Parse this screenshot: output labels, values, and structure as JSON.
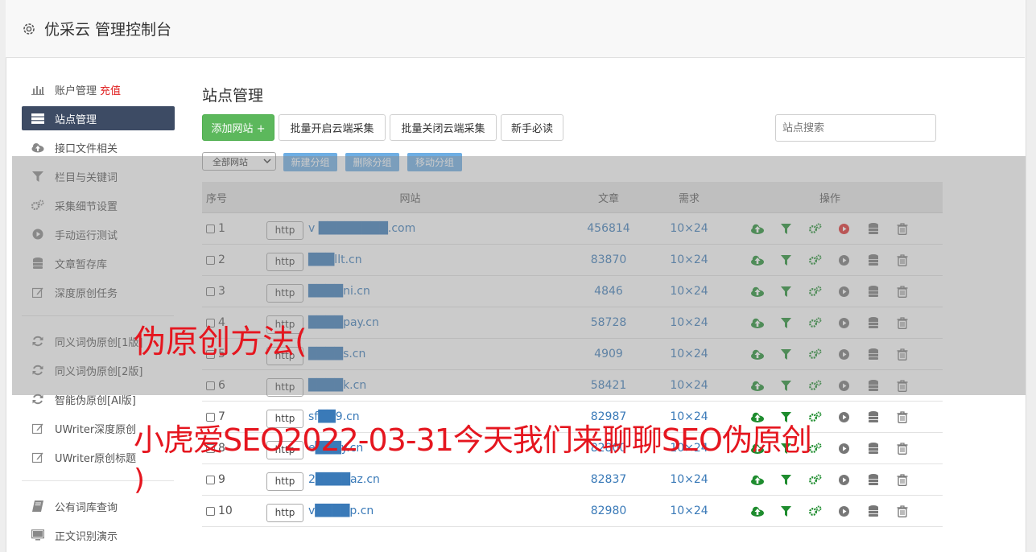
{
  "app": {
    "title": "优采云 管理控制台",
    "icon": "gear-icon"
  },
  "sidebar": {
    "groups": [
      [
        {
          "label": "账户管理",
          "extra": "充值",
          "icon": "bar-chart-icon"
        },
        {
          "label": "站点管理",
          "icon": "server-icon",
          "active": true
        },
        {
          "label": "接口文件相关",
          "icon": "cloud-upload-icon"
        },
        {
          "label": "栏目与关键词",
          "icon": "filter-icon"
        },
        {
          "label": "采集细节设置",
          "icon": "cogs-icon"
        },
        {
          "label": "手动运行测试",
          "icon": "play-circle-icon"
        },
        {
          "label": "文章暂存库",
          "icon": "database-icon"
        },
        {
          "label": "深度原创任务",
          "icon": "edit-icon"
        }
      ],
      [
        {
          "label": "同义词伪原创[1版]",
          "icon": "refresh-icon"
        },
        {
          "label": "同义词伪原创[2版]",
          "icon": "refresh-icon"
        },
        {
          "label": "智能伪原创[AI版]",
          "icon": "refresh-icon"
        },
        {
          "label": "UWriter深度原创",
          "icon": "edit-icon"
        },
        {
          "label": "UWriter原创标题",
          "icon": "edit-icon"
        }
      ],
      [
        {
          "label": "公有词库查询",
          "icon": "book-icon"
        },
        {
          "label": "正文识别演示",
          "icon": "monitor-icon"
        }
      ]
    ]
  },
  "main": {
    "title": "站点管理",
    "toolbar": {
      "add_site": "添加网站 +",
      "batch_open": "批量开启云端采集",
      "batch_close": "批量关闭云端采集",
      "newbie": "新手必读",
      "search_placeholder": "站点搜索"
    },
    "group_select": "全部网站",
    "group_buttons": {
      "new": "新建分组",
      "delete": "删除分组",
      "move": "移动分组"
    },
    "table": {
      "headers": {
        "no": "序号",
        "site": "网站",
        "articles": "文章",
        "demand": "需求",
        "ops": "操作"
      },
      "protocol_label": "http",
      "rows": [
        {
          "no": "1",
          "domain": "v ████████.com",
          "articles": "456814",
          "demand": "10×24",
          "play_active": true
        },
        {
          "no": "2",
          "domain": "███llt.cn",
          "articles": "83870",
          "demand": "10×24",
          "play_active": false
        },
        {
          "no": "3",
          "domain": "████ni.cn",
          "articles": "4846",
          "demand": "10×24",
          "play_active": false
        },
        {
          "no": "4",
          "domain": "████pay.cn",
          "articles": "58728",
          "demand": "10×24",
          "play_active": false
        },
        {
          "no": "5",
          "domain": "████s.cn",
          "articles": "4909",
          "demand": "10×24",
          "play_active": false
        },
        {
          "no": "6",
          "domain": "████k.cn",
          "articles": "58421",
          "demand": "10×24",
          "play_active": false
        },
        {
          "no": "7",
          "domain": "sf██9.cn",
          "articles": "82987",
          "demand": "10×24",
          "play_active": false
        },
        {
          "no": "8",
          "domain": "e███y.cn",
          "articles": "82800",
          "demand": "10×24",
          "play_active": false
        },
        {
          "no": "9",
          "domain": "2████az.cn",
          "articles": "82837",
          "demand": "10×24",
          "play_active": false
        },
        {
          "no": "10",
          "domain": "v████p.cn",
          "articles": "82980",
          "demand": "10×24",
          "play_active": false
        }
      ]
    }
  },
  "overlay": {
    "line1": "伪原创方法(",
    "line2": "小虎爱SEO2022-03-31今天我们来聊聊SEO伪原创",
    "line3": ")"
  },
  "colors": {
    "accent_green": "#5cb85c",
    "sidebar_active": "#3d4b64",
    "link_blue": "#3a7ab8",
    "overlay_red": "#e5161f",
    "group_button_blue": "#6eaee3"
  }
}
